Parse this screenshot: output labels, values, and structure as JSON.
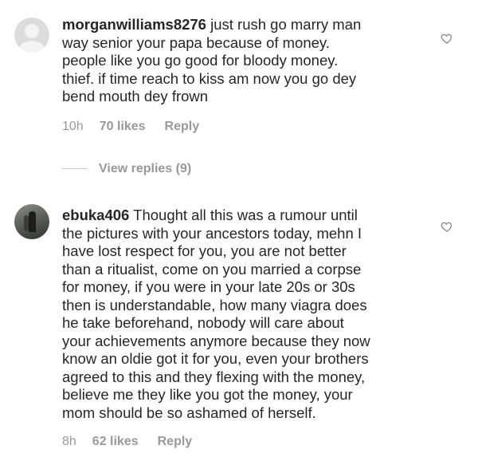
{
  "comments": [
    {
      "username": "morganwilliams8276",
      "text": "just rush go marry man\nway senior your papa because of money.\npeople like you go good for bloody money.\nthief. if time reach to kiss am now you go dey\nbend mouth dey frown",
      "time": "10h",
      "likes": "70 likes",
      "reply_label": "Reply",
      "view_replies": "View replies (9)",
      "avatar": "default-avatar-icon",
      "like_icon": "heart-outline-icon"
    },
    {
      "username": "ebuka406",
      "text": "Thought all this was a rumour until\nthe pictures with your ancestors today, mehn I\nhave lost respect for you, you are not better\nthan a ritualist, come on you married a corpse\nfor money, if you were in your late 20s or 30s\nthen is understandable, how many viagra does\nhe take beforehand, nobody will care about\nyour achievements anymore because they now\nknow an oldie got it for you, even your brothers\nagreed to this and they flexing with the money,\nbelieve me they like you got the money, your\nmom should be so ashamed of herself.",
      "time": "8h",
      "likes": "62 likes",
      "reply_label": "Reply",
      "avatar": "user-photo-avatar",
      "like_icon": "heart-outline-icon"
    }
  ],
  "colors": {
    "text": "#262626",
    "meta": "#999999",
    "background": "#ffffff"
  }
}
